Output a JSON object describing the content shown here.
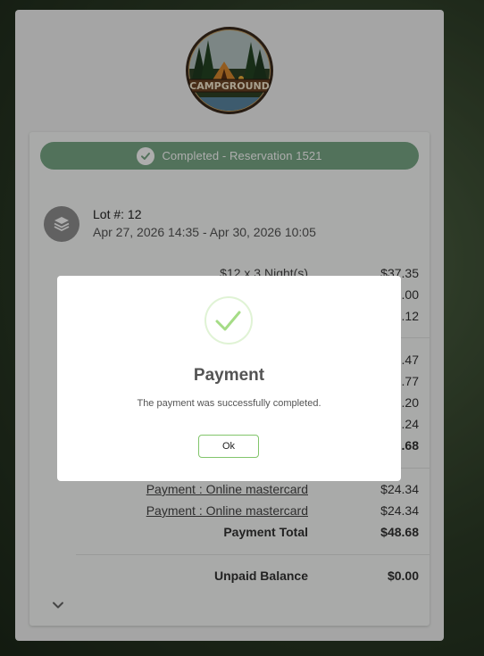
{
  "logo": {
    "text": "CAMPGROUND"
  },
  "reservation": {
    "status": "Completed - Reservation 1521",
    "lot": "Lot #: 12",
    "dates": "Apr 27, 2026 14:35 - Apr 30, 2026 10:05"
  },
  "charges": [
    {
      "label": "$12 x 3 Night(s)",
      "value": "$37.35"
    },
    {
      "label": "",
      "value": ".00"
    },
    {
      "label": "",
      "value": ".12"
    },
    {
      "label": "",
      "value": ".47"
    },
    {
      "label": "",
      "value": ".77"
    },
    {
      "label": "",
      "value": ".20"
    },
    {
      "label": "",
      "value": ".24"
    },
    {
      "label": "",
      "value": ".68"
    }
  ],
  "payments": [
    {
      "label": "Payment : Online mastercard",
      "value": "$24.34"
    },
    {
      "label": "Payment : Online mastercard",
      "value": "$24.34"
    }
  ],
  "payment_total": {
    "label": "Payment Total",
    "value": "$48.68"
  },
  "unpaid": {
    "label": "Unpaid Balance",
    "value": "$0.00"
  },
  "modal": {
    "title": "Payment",
    "message": "The payment was successfully completed.",
    "ok_label": "Ok"
  },
  "colors": {
    "status_green": "#7aa886",
    "success_green": "#a5dc86",
    "ok_border": "#82c56b"
  },
  "icons": {
    "status": "check-circle-icon",
    "lot": "layers-icon",
    "expand": "chevron-down-icon",
    "modal": "success-check-icon"
  }
}
